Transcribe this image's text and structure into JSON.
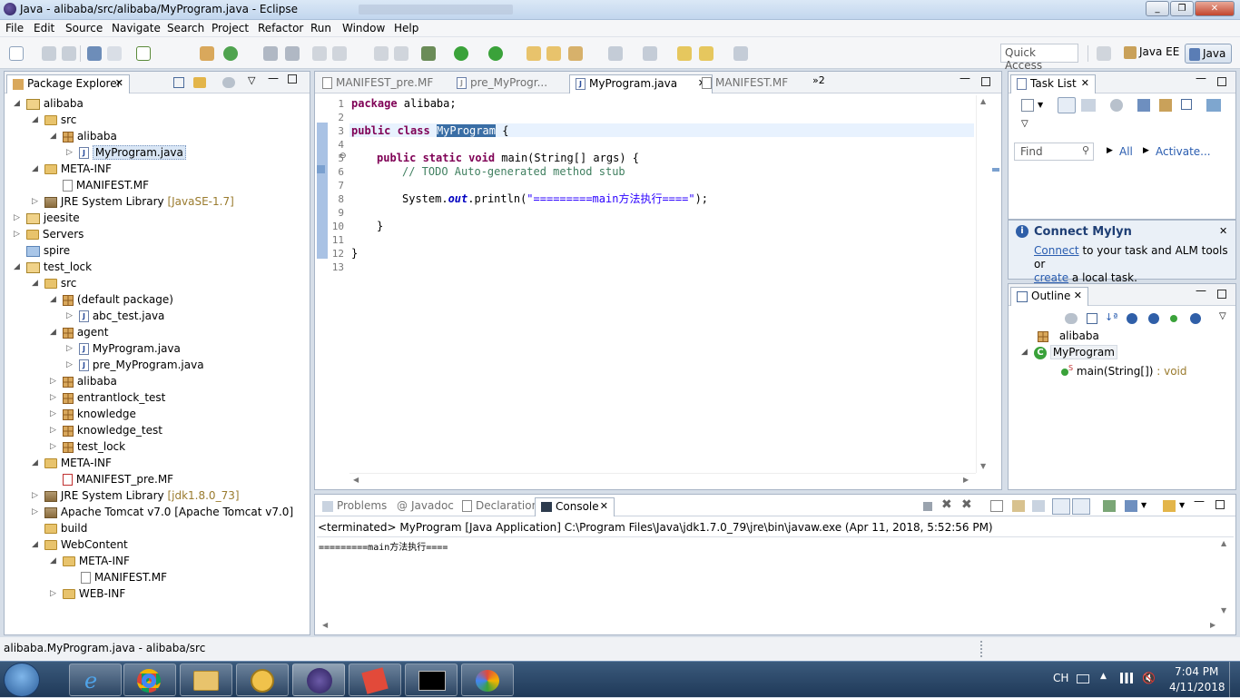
{
  "window": {
    "title": "Java - alibaba/src/alibaba/MyProgram.java - Eclipse"
  },
  "menu": [
    "File",
    "Edit",
    "Source",
    "Navigate",
    "Search",
    "Project",
    "Refactor",
    "Run",
    "Window",
    "Help"
  ],
  "toolbar": {
    "quick_access": "Quick Access",
    "perspective_javaee": "Java EE",
    "perspective_java": "Java"
  },
  "package_explorer": {
    "title": "Package Explorer",
    "rows": [
      {
        "label": "alibaba",
        "extra": ""
      },
      {
        "label": "src",
        "extra": ""
      },
      {
        "label": "alibaba",
        "extra": ""
      },
      {
        "label": "MyProgram.java",
        "extra": ""
      },
      {
        "label": "META-INF",
        "extra": ""
      },
      {
        "label": "MANIFEST.MF",
        "extra": ""
      },
      {
        "label": "JRE System Library",
        "extra": "[JavaSE-1.7]"
      },
      {
        "label": "jeesite",
        "extra": ""
      },
      {
        "label": "Servers",
        "extra": ""
      },
      {
        "label": "spire",
        "extra": ""
      },
      {
        "label": "test_lock",
        "extra": ""
      },
      {
        "label": "src",
        "extra": ""
      },
      {
        "label": "(default package)",
        "extra": ""
      },
      {
        "label": "abc_test.java",
        "extra": ""
      },
      {
        "label": "agent",
        "extra": ""
      },
      {
        "label": "MyProgram.java",
        "extra": ""
      },
      {
        "label": "pre_MyProgram.java",
        "extra": ""
      },
      {
        "label": "alibaba",
        "extra": ""
      },
      {
        "label": "entrantlock_test",
        "extra": ""
      },
      {
        "label": "knowledge",
        "extra": ""
      },
      {
        "label": "knowledge_test",
        "extra": ""
      },
      {
        "label": "test_lock",
        "extra": ""
      },
      {
        "label": "META-INF",
        "extra": ""
      },
      {
        "label": "MANIFEST_pre.MF",
        "extra": ""
      },
      {
        "label": "JRE System Library",
        "extra": "[jdk1.8.0_73]"
      },
      {
        "label": "Apache Tomcat v7.0 [Apache Tomcat v7.0]",
        "extra": ""
      },
      {
        "label": "build",
        "extra": ""
      },
      {
        "label": "WebContent",
        "extra": ""
      },
      {
        "label": "META-INF",
        "extra": ""
      },
      {
        "label": "MANIFEST.MF",
        "extra": ""
      },
      {
        "label": "WEB-INF",
        "extra": ""
      }
    ]
  },
  "editor": {
    "tabs": [
      "MANIFEST_pre.MF",
      "pre_MyProgr...",
      "MyProgram.java",
      "MANIFEST.MF"
    ],
    "overflow": "»2",
    "line_numbers": [
      "1",
      "2",
      "3",
      "4",
      "5",
      "6",
      "7",
      "8",
      "9",
      "10",
      "11",
      "12",
      "13"
    ],
    "code": {
      "l1_kw": "package",
      "l1_rest": " alibaba;",
      "l3_kw": "public class",
      "l3_cls": "MyProgram",
      "l3_rest": " {",
      "l5_kw": "public static void",
      "l5_rest": " main(String[] args) {",
      "l6_cm": "// TODO Auto-generated method stub",
      "l8_a": "System.",
      "l8_out": "out",
      "l8_b": ".println(",
      "l8_str": "\"=========main方法执行====\"",
      "l8_c": ");",
      "l10": "}",
      "l12": "}"
    }
  },
  "task_list": {
    "title": "Task List",
    "find_placeholder": "Find",
    "all": "All",
    "activate": "Activate..."
  },
  "mylyn": {
    "title": "Connect Mylyn",
    "connect": "Connect",
    "text1": " to your task and ALM tools or",
    "create": "create",
    "text2": " a local task."
  },
  "outline": {
    "title": "Outline",
    "package": "alibaba",
    "class": "MyProgram",
    "method": "main(String[])",
    "method_type": " : void"
  },
  "console": {
    "tabs": [
      "Problems",
      "Javadoc",
      "Declaration",
      "Console"
    ],
    "header": "<terminated> MyProgram [Java Application] C:\\Program Files\\Java\\jdk1.7.0_79\\jre\\bin\\javaw.exe (Apr 11, 2018, 5:52:56 PM)",
    "output": "=========main方法执行===="
  },
  "status": {
    "text": "alibaba.MyProgram.java - alibaba/src"
  },
  "taskbar": {
    "lang": "CH",
    "time": "7:04 PM",
    "date": "4/11/2018"
  },
  "colors": {
    "accent": "#3a6ea5",
    "keyword": "#7f0055",
    "comment": "#3f7f5f",
    "string": "#2a00ff",
    "field": "#0000c0"
  }
}
